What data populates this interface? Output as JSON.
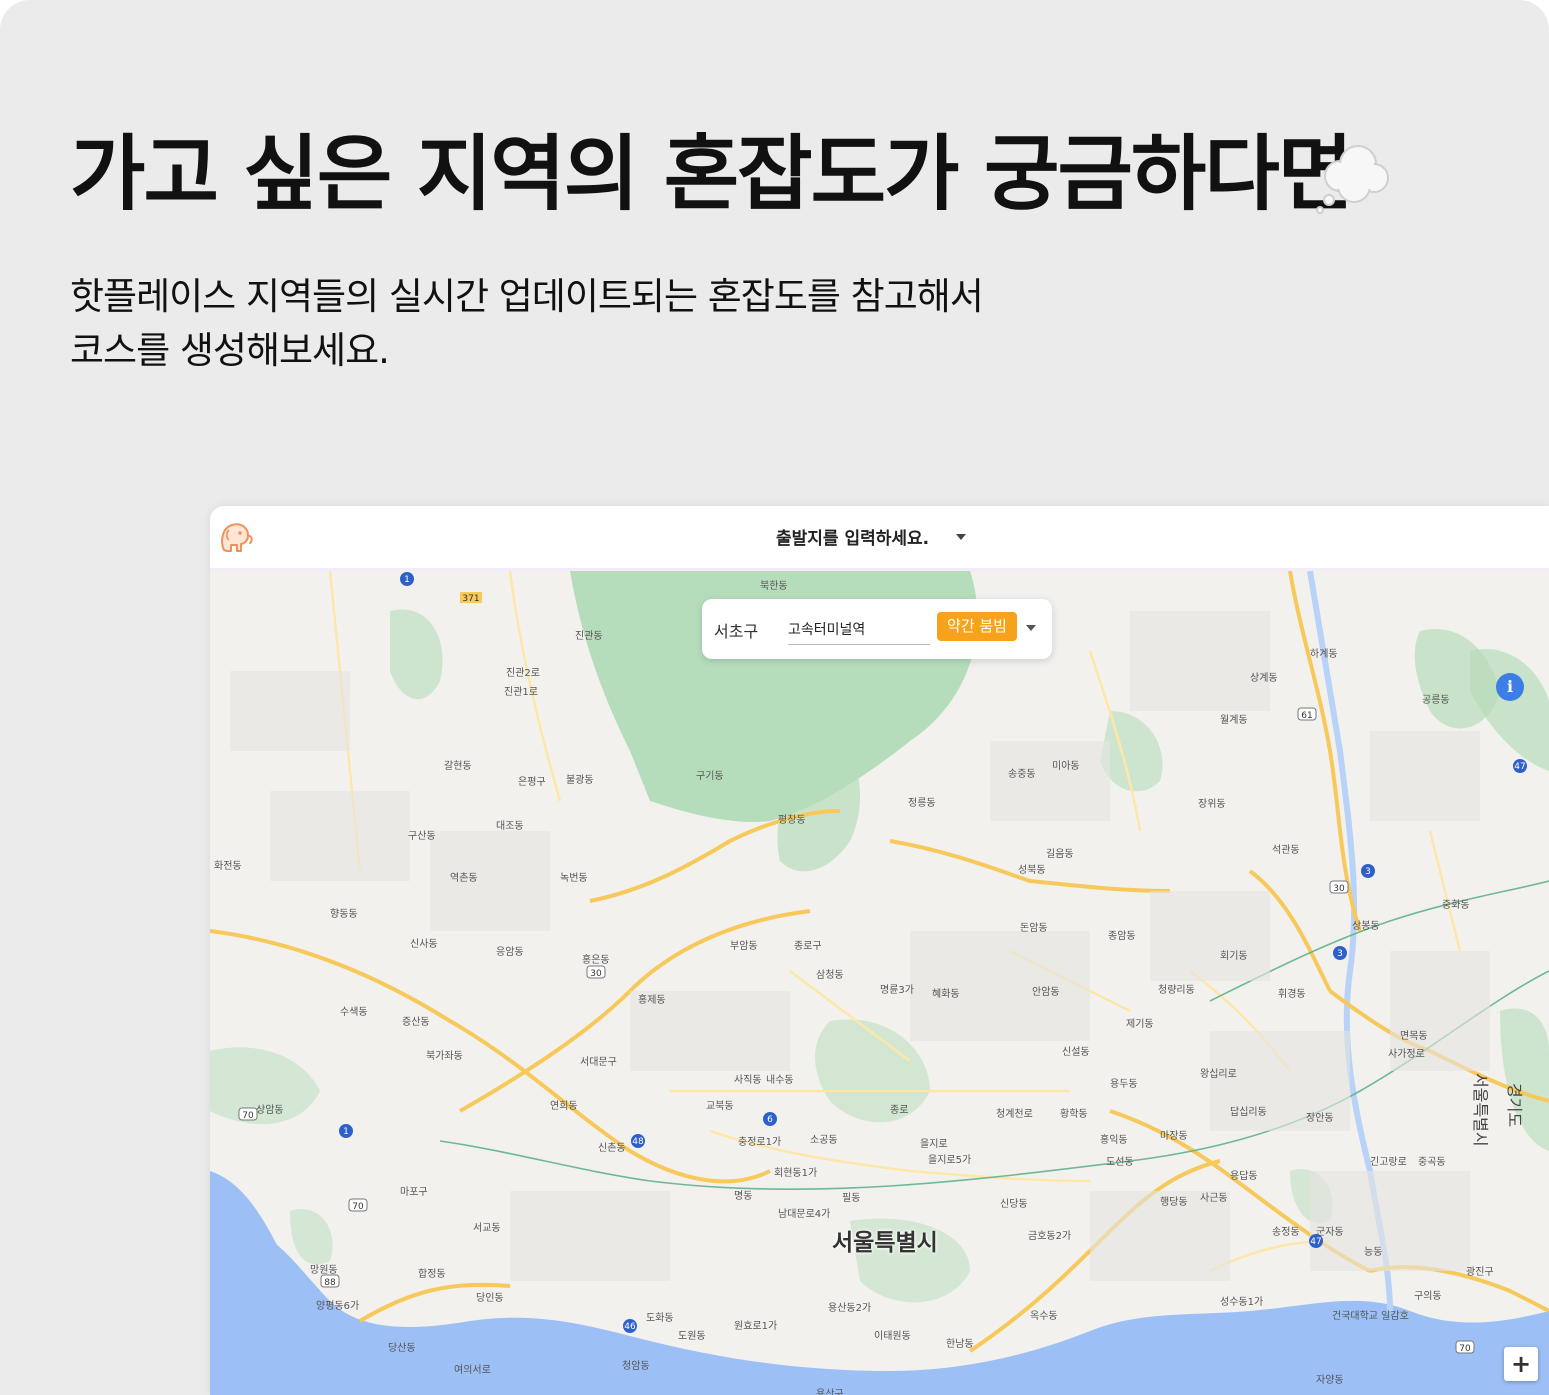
{
  "hero": {
    "title": "가고 싶은 지역의 혼잡도가 궁금하다면",
    "title_icon": "thought-balloon-icon",
    "subtitle_lines": [
      "핫플레이스 지역들의 실시간 업데이트되는 혼잡도를 참고해서",
      "코스를 생성해보세요."
    ]
  },
  "app": {
    "logo_icon": "elephant-logo-icon",
    "origin_placeholder": "출발지를 입력하세요.",
    "info_panel": {
      "district": "서초구",
      "place": "고속터미널역",
      "status": "약간 붐빔",
      "status_color": "#f7a21b"
    },
    "map": {
      "city_label": "서울특별시",
      "side_labels": [
        "서울특별시",
        "경기도"
      ],
      "labels": [
        "북한동",
        "진관동",
        "진관2로",
        "진관1로",
        "구기동",
        "평창동",
        "정릉동",
        "성북동",
        "부암동",
        "종로구",
        "삼청동",
        "명륜3가",
        "혜화동",
        "대조동",
        "역촌동",
        "응암동",
        "홍은동",
        "홍제동",
        "북가좌동",
        "연희동",
        "신촌동",
        "마포구",
        "서교동",
        "합정동",
        "당인동",
        "서대문구",
        "사직동",
        "내수동",
        "교북동",
        "충정로1가",
        "소공동",
        "회현동1가",
        "남대문로4가",
        "명동",
        "필동",
        "을지로5가",
        "신당동",
        "금호동2가",
        "옥수동",
        "한남동",
        "이태원동",
        "용산구",
        "용산동2가",
        "원효로1가",
        "도원동",
        "도화동",
        "청암동",
        "망원동",
        "양평동6가",
        "당산동",
        "여의서로",
        "상봉동",
        "면목동",
        "중화동",
        "석관동",
        "장위동",
        "월계동",
        "공릉동",
        "하계동",
        "상계동",
        "미아동",
        "송중동",
        "돈암동",
        "안암동",
        "제기동",
        "청량리동",
        "회기동",
        "휘경동",
        "답십리동",
        "장안동",
        "용답동",
        "사근동",
        "행당동",
        "성수동1가",
        "자양동",
        "구의동",
        "광진구",
        "능동",
        "군자동",
        "송정동",
        "중곡동",
        "긴고랑로",
        "사가정로",
        "건국대학교 일감호",
        "종암동",
        "길음동",
        "신설동",
        "용두동",
        "마장동",
        "홍익동",
        "도선동",
        "황학동",
        "왕십리로",
        "을지로",
        "종로",
        "청계천로",
        "수색동",
        "상암동",
        "증산동",
        "화전동",
        "신사동",
        "구산동",
        "갈현동",
        "불광동",
        "녹번동",
        "은평구",
        "향동동"
      ],
      "highway_numbers": [
        "1",
        "371",
        "30",
        "70",
        "6",
        "3",
        "47",
        "61",
        "46",
        "88",
        "48"
      ]
    },
    "controls": {
      "info_button": "i",
      "zoom_in": "+"
    }
  }
}
